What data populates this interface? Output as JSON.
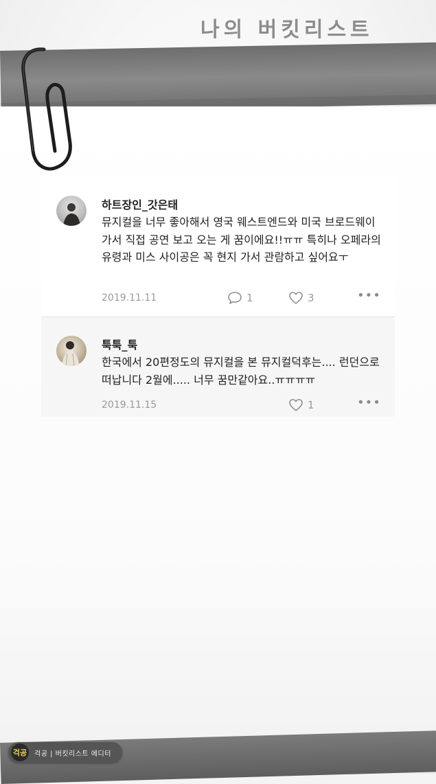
{
  "header": {
    "title": "나의 버킷리스트"
  },
  "comments": [
    {
      "author": "하트장인_갓은태",
      "text": "뮤지컬을 너무 좋아해서 영국 웨스트엔드와 미국 브로드웨이 가서 직접 공연 보고 오는 게 꿈이에요!!ㅠㅠ 특히나 오페라의 유령과 미스 사이공은 꼭 현지 가서 관람하고 싶어요ㅜ",
      "date": "2019.11.11",
      "reply_count": "1",
      "like_count": "3",
      "more": "•••"
    },
    {
      "author": "툭툭_툭",
      "text": "한국에서 20편정도의 뮤지컬을 본 뮤지컬덕후는.... 런던으로 떠납니다 2월에..... 너무 꿈만같아요..ㅠㅠㅠㅠ",
      "date": "2019.11.15",
      "like_count": "1",
      "more": "•••"
    }
  ],
  "footer": {
    "logo": "걱공",
    "text": "걱공 | 버킷리스트 에디터"
  },
  "icons": {
    "reply": "speech-bubble-icon",
    "like": "heart-icon",
    "more": "more-dots-icon",
    "clip": "paperclip-icon"
  },
  "colors": {
    "band": "#7a7a7a",
    "meta_text": "#9a9a9a",
    "footer_logo": "#e7d45c"
  }
}
